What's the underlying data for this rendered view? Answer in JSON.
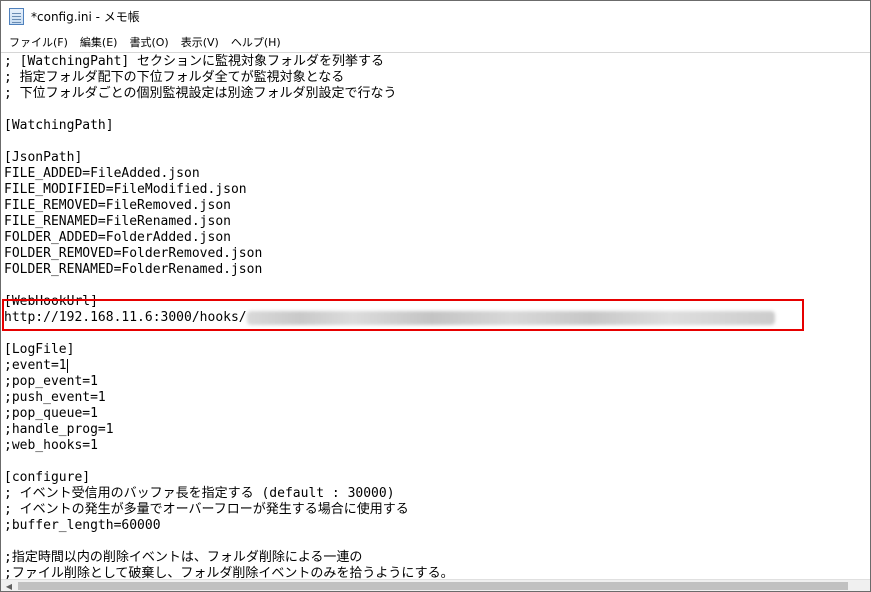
{
  "window": {
    "title": "*config.ini - メモ帳",
    "icon": "notepad-icon"
  },
  "menu": {
    "items": [
      "ファイル(F)",
      "編集(E)",
      "書式(O)",
      "表示(V)",
      "ヘルプ(H)"
    ]
  },
  "editor": {
    "lines": [
      "; [WatchingPaht] セクションに監視対象フォルダを列挙する",
      "; 指定フォルダ配下の下位フォルダ全てが監視対象となる",
      "; 下位フォルダごとの個別監視設定は別途フォルダ別設定で行なう",
      "",
      "[WatchingPath]",
      "",
      "[JsonPath]",
      "FILE_ADDED=FileAdded.json",
      "FILE_MODIFIED=FileModified.json",
      "FILE_REMOVED=FileRemoved.json",
      "FILE_RENAMED=FileRenamed.json",
      "FOLDER_ADDED=FolderAdded.json",
      "FOLDER_REMOVED=FolderRemoved.json",
      "FOLDER_RENAMED=FolderRenamed.json",
      "",
      "[WebHookUrl]",
      "http://192.168.11.6:3000/hooks/",
      "",
      "[LogFile]",
      ";event=1",
      ";pop_event=1",
      ";push_event=1",
      ";pop_queue=1",
      ";handle_prog=1",
      ";web_hooks=1",
      "",
      "[configure]",
      "; イベント受信用のバッファ長を指定する (default : 30000)",
      "; イベントの発生が多量でオーバーフローが発生する場合に使用する",
      ";buffer_length=60000",
      "",
      ";指定時間以内の削除イベントは、フォルダ削除による一連の",
      ";ファイル削除として破棄し、フォルダ削除イベントのみを拾うようにする。"
    ]
  },
  "annotation": {
    "highlight_color": "#e60000"
  }
}
